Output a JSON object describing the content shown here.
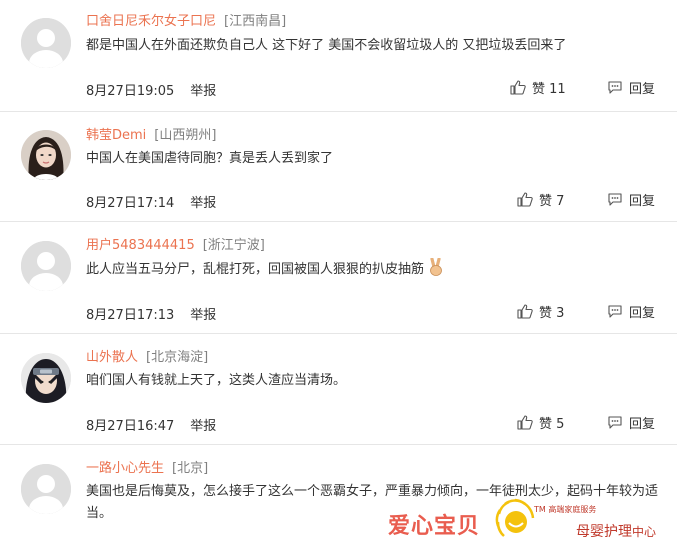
{
  "comments": [
    {
      "username": "口舍日尼禾尔女子口尼",
      "location": "[江西南昌]",
      "text": "都是中国人在外面还欺负自己人 这下好了 美国不会收留垃圾人的 又把垃圾丢回来了",
      "time": "8月27日19:05",
      "report": "举报",
      "likes": "赞 11",
      "reply": "回复",
      "avatar": "default-avatar"
    },
    {
      "username": "韩莹Demi",
      "location": "[山西朔州]",
      "text": "中国人在美国虐待同胞？真是丢人丢到家了",
      "time": "8月27日17:14",
      "report": "举报",
      "likes": "赞 7",
      "reply": "回复",
      "avatar": "woman-photo-avatar"
    },
    {
      "username": "用户5483444415",
      "location": "[浙江宁波]",
      "text": "此人应当五马分尸，乱棍打死，回国被国人狠狠的扒皮抽筋",
      "time": "8月27日17:13",
      "report": "举报",
      "likes": "赞 3",
      "reply": "回复",
      "avatar": "default-avatar",
      "emoji": "victory-hand"
    },
    {
      "username": "山外散人",
      "location": "[北京海淀]",
      "text": "咱们国人有钱就上天了，这类人渣应当清场。",
      "time": "8月27日16:47",
      "report": "举报",
      "likes": "赞 5",
      "reply": "回复",
      "avatar": "anime-ninja-avatar"
    },
    {
      "username": "一路小心先生",
      "location": "[北京]",
      "text": "美国也是后悔莫及，怎么接手了这么一个恶霸女子，严重暴力倾向，一年徒刑太少，起码十年较为适当。",
      "avatar": "default-avatar"
    }
  ],
  "watermark": {
    "left": "爱心宝贝",
    "tm": "TM 高端家庭服务",
    "right": "母婴护理",
    "right_small": "中心"
  },
  "colors": {
    "username": "#eb7350",
    "location": "#808080",
    "divider": "#e6e6e6",
    "watermark": "#c0392b"
  }
}
